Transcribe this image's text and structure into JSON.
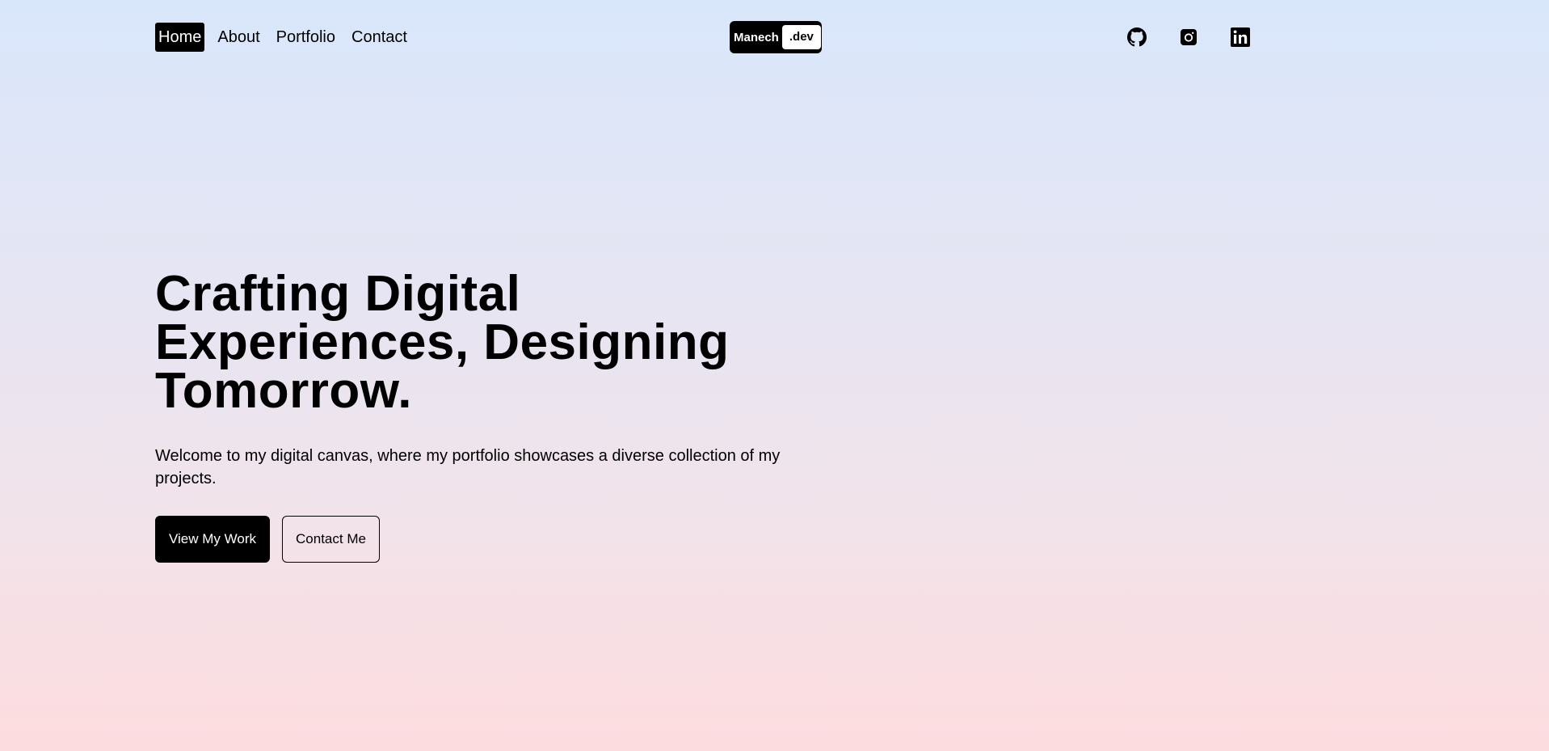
{
  "nav": {
    "items": [
      {
        "label": "Home",
        "active": true
      },
      {
        "label": "About",
        "active": false
      },
      {
        "label": "Portfolio",
        "active": false
      },
      {
        "label": "Contact",
        "active": false
      }
    ]
  },
  "logo": {
    "name": "Manech",
    "tld": ".dev"
  },
  "socials": [
    {
      "icon": "github-icon"
    },
    {
      "icon": "instagram-icon"
    },
    {
      "icon": "linkedin-icon"
    }
  ],
  "hero": {
    "title_lines": [
      "Crafting Digital",
      "Experiences, Designing",
      "Tomorrow."
    ],
    "subtitle": "Welcome to my digital canvas, where my portfolio showcases a diverse collection of my projects.",
    "primary_button": "View My Work",
    "secondary_button": "Contact Me"
  },
  "colors": {
    "gradient_top": "#d9e7fb",
    "gradient_bottom": "#fddcdf",
    "accent": "#000000"
  }
}
